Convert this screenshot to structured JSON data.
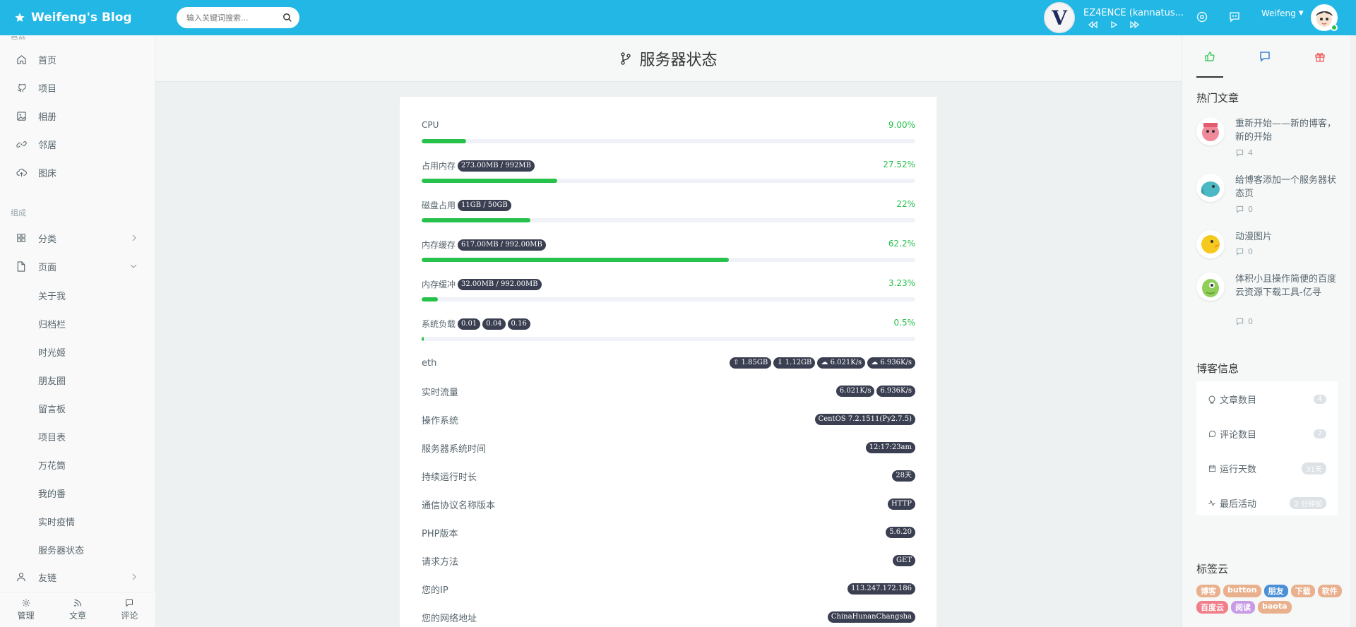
{
  "header": {
    "brand": "Weifeng's Blog",
    "search_placeholder": "输入关键词搜索...",
    "player": {
      "cover_letter": "V",
      "track": "EZ4ENCE (kannatus..."
    },
    "user": "Weifeng"
  },
  "sidebar": {
    "top_label": "导航",
    "items": [
      {
        "label": "首页",
        "icon": "home-icon"
      },
      {
        "label": "项目",
        "icon": "github-icon"
      },
      {
        "label": "相册",
        "icon": "image-icon"
      },
      {
        "label": "邻居",
        "icon": "link-icon"
      },
      {
        "label": "图床",
        "icon": "upload-cloud-icon"
      }
    ],
    "group_label": "组成",
    "categories": "分类",
    "pages": "页面",
    "sub_pages": [
      "关于我",
      "归档栏",
      "时光姬",
      "朋友圈",
      "留言板",
      "项目表",
      "万花筒",
      "我的番",
      "实时疫情",
      "服务器状态"
    ],
    "friends": "友链",
    "footer": {
      "manage": "管理",
      "articles": "文章",
      "comments": "评论"
    }
  },
  "main": {
    "title": "服务器状态",
    "stats": [
      {
        "label": "CPU",
        "badges": [],
        "percent_text": "9.00%",
        "percent": 9.0
      },
      {
        "label": "占用内存",
        "badges": [
          "273.00MB / 992MB"
        ],
        "percent_text": "27.52%",
        "percent": 27.52
      },
      {
        "label": "磁盘占用",
        "badges": [
          "11GB / 50GB"
        ],
        "percent_text": "22%",
        "percent": 22
      },
      {
        "label": "内存缓存",
        "badges": [
          "617.00MB / 992.00MB"
        ],
        "percent_text": "62.2%",
        "percent": 62.2
      },
      {
        "label": "内存缓冲",
        "badges": [
          "32.00MB / 992.00MB"
        ],
        "percent_text": "3.23%",
        "percent": 3.23
      },
      {
        "label": "系统负载",
        "badges": [
          "0.01",
          "0.04",
          "0.16"
        ],
        "percent_text": "0.5%",
        "percent": 0.5
      }
    ],
    "eth": {
      "label": "eth",
      "badges": [
        "1.85GB",
        "1.12GB",
        "6.021K/s",
        "6.936K/s"
      ]
    },
    "rows": [
      {
        "label": "实时流量",
        "values": [
          "6.021K/s",
          "6.936K/s"
        ]
      },
      {
        "label": "操作系统",
        "values": [
          "CentOS 7.2.1511(Py2.7.5)"
        ]
      },
      {
        "label": "服务器系统时间",
        "values": [
          "12:17:23am"
        ]
      },
      {
        "label": "持续运行时长",
        "values": [
          "28天"
        ]
      },
      {
        "label": "通信协议名称版本",
        "values": [
          "HTTP"
        ]
      },
      {
        "label": "PHP版本",
        "values": [
          "5.6.20"
        ]
      },
      {
        "label": "请求方法",
        "values": [
          "GET"
        ]
      },
      {
        "label": "您的IP",
        "values": [
          "113.247.172.186"
        ]
      },
      {
        "label": "您的网络地址",
        "values": [
          "ChinaHunanChangsha"
        ]
      }
    ]
  },
  "aside": {
    "hot_title": "热门文章",
    "hot_posts": [
      {
        "title": "重新开始——新的博客，新的开始",
        "comments": "4",
        "color": "#f08a9b"
      },
      {
        "title": "给博客添加一个服务器状态页",
        "comments": "0",
        "color": "#4bb8c4"
      },
      {
        "title": "动漫图片",
        "comments": "0",
        "color": "#f6c91e"
      },
      {
        "title": "体积小且操作简便的百度云资源下载工具-亿寻",
        "comments": "0",
        "color": "#8fce5a"
      }
    ],
    "info_title": "博客信息",
    "info": [
      {
        "label": "文章数目",
        "value": "4",
        "icon": "bulb-icon"
      },
      {
        "label": "评论数目",
        "value": "7",
        "icon": "comment-icon"
      },
      {
        "label": "运行天数",
        "value": "31天",
        "icon": "calendar-icon"
      },
      {
        "label": "最后活动",
        "value": "2 分钟前",
        "icon": "activity-icon"
      }
    ],
    "tags_title": "标签云",
    "tags": [
      {
        "label": "博客",
        "color": "#e9b08e"
      },
      {
        "label": "button",
        "color": "#e9b08e"
      },
      {
        "label": "朋友",
        "color": "#4b8fd6"
      },
      {
        "label": "下载",
        "color": "#e9b08e"
      },
      {
        "label": "软件",
        "color": "#e9b08e"
      },
      {
        "label": "百度云",
        "color": "#f07f8a"
      },
      {
        "label": "阅读",
        "color": "#c79be5"
      },
      {
        "label": "baota",
        "color": "#e9b08e"
      }
    ]
  },
  "colors": {
    "primary": "#23b7e5",
    "success": "#27c24c",
    "badge": "#3a3f51"
  }
}
